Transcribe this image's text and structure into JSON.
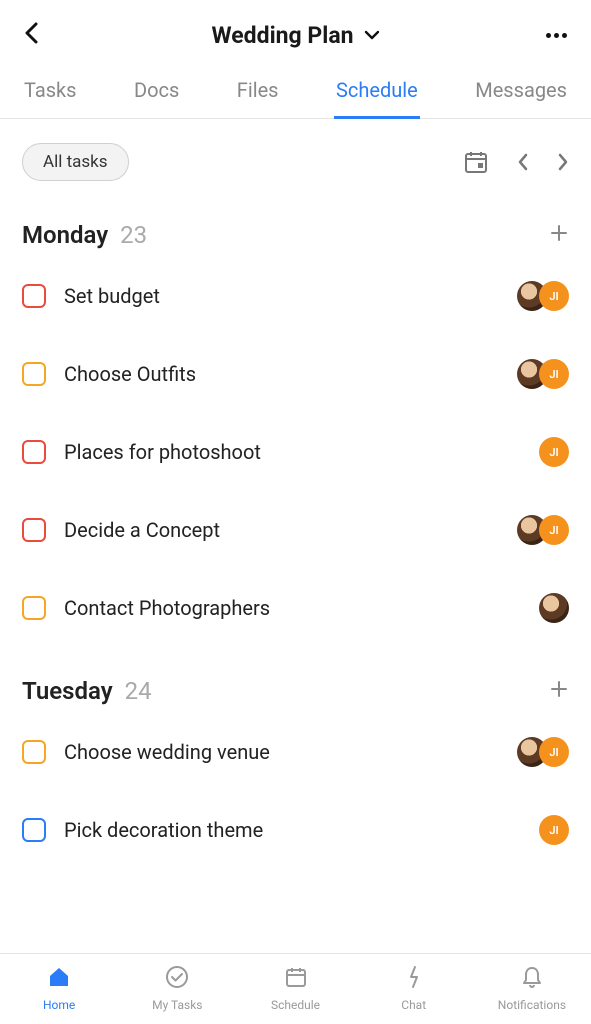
{
  "header": {
    "title": "Wedding Plan"
  },
  "tabs": [
    "Tasks",
    "Docs",
    "Files",
    "Schedule",
    "Messages"
  ],
  "active_tab_index": 3,
  "filter_label": "All tasks",
  "colors": {
    "accent": "#2a7df6",
    "check_red": "#e94b3c",
    "check_orange": "#f5a623",
    "check_blue": "#2a7df6",
    "avatar_orange": "#f5921e"
  },
  "days": [
    {
      "name": "Monday",
      "number": "23",
      "tasks": [
        {
          "title": "Set budget",
          "check_color": "check_red",
          "avatars": [
            "photo",
            "JI"
          ]
        },
        {
          "title": "Choose Outfits",
          "check_color": "check_orange",
          "avatars": [
            "photo",
            "JI"
          ]
        },
        {
          "title": "Places for photoshoot",
          "check_color": "check_red",
          "avatars": [
            "JI"
          ]
        },
        {
          "title": "Decide a Concept",
          "check_color": "check_red",
          "avatars": [
            "photo",
            "JI"
          ]
        },
        {
          "title": "Contact Photographers",
          "check_color": "check_orange",
          "avatars": [
            "photo"
          ]
        }
      ]
    },
    {
      "name": "Tuesday",
      "number": "24",
      "tasks": [
        {
          "title": "Choose wedding venue",
          "check_color": "check_orange",
          "avatars": [
            "photo",
            "JI"
          ]
        },
        {
          "title": "Pick decoration theme",
          "check_color": "check_blue",
          "avatars": [
            "JI"
          ]
        }
      ]
    }
  ],
  "bottom_nav": [
    "Home",
    "My Tasks",
    "Schedule",
    "Chat",
    "Notifications"
  ],
  "active_nav_index": 0
}
